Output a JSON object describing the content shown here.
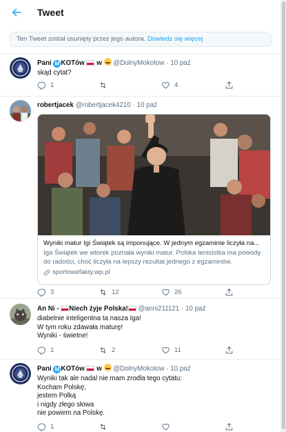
{
  "header": {
    "title": "Tweet"
  },
  "notice": {
    "text": "Ten Tweet został usunięty przez jego autora.",
    "link": "Dowiedz się więcej"
  },
  "tweets": [
    {
      "name_pre": "Pani ",
      "name_post": "KOTów",
      "name_w": " w ",
      "handle": "@DolnyMokotow",
      "time": "10 paź",
      "text": "skąd cytat?",
      "reply_count": "1",
      "retweet_count": "",
      "like_count": "4"
    },
    {
      "name": "robertjacek",
      "handle": "@robertjacek4210",
      "time": "10 paź",
      "text": "",
      "card": {
        "title": "Wyniki matur Igi Świątek są imponujące. W jednym egzaminie liczyła na...",
        "description": "Iga Świątek we wtorek poznała wyniki matur. Polska tenisistka ma powody do radości, choć liczyła na lepszy rezultat jednego z egzaminów.",
        "link": "sportowefakty.wp.pl"
      },
      "reply_count": "3",
      "retweet_count": "12",
      "like_count": "26"
    },
    {
      "name_pre": "An Ni - ",
      "name_mid": "Niech żyje Polska!",
      "handle": "@anni211121",
      "time": "10 paź",
      "text": "diabelnie inteligentna ta nasza Iga!\nW tym roku zdawała maturę!\nWyniki - świetne!",
      "reply_count": "1",
      "retweet_count": "2",
      "like_count": "11"
    },
    {
      "name_pre": "Pani ",
      "name_post": "KOTów",
      "name_w": " w ",
      "handle": "@DolnyMokotow",
      "time": "10 paź",
      "text": "Wyniki tak ale nadal nie mam zrodla tego cytatu:\nKocham Polskę,\njestem Polką\ni nigdy złego słowa\nnie powiem na Polskę.",
      "reply_count": "1",
      "retweet_count": "",
      "like_count": ""
    }
  ],
  "colors": {
    "accent": "#1da1f2",
    "muted": "#5b7083",
    "border": "#e6ecf0"
  },
  "icons": [
    "back-arrow-icon",
    "reply-icon",
    "retweet-icon",
    "like-icon",
    "share-icon",
    "link-icon"
  ]
}
